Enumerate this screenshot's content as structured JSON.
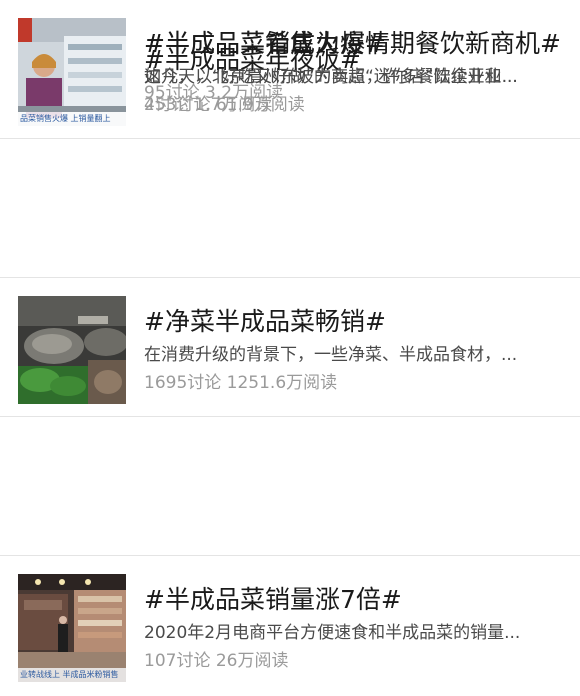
{
  "topics": [
    {
      "title": "#半成品菜肴成为疫情期餐饮新商机#",
      "summary": "这几天，北京眉州东坡的商超“迷你店”陆续开业...",
      "discussions": "453讨论",
      "reads": "61.9万阅读",
      "thumbnail_icon": "staff-masks-store-photo"
    },
    {
      "title": "#净菜半成品菜畅销#",
      "summary": "在消费升级的背景下，一些净菜、半成品食材，...",
      "discussions": "1695讨论",
      "reads": "1251.6万阅读",
      "thumbnail_icon": "packaged-vegetables-photo"
    },
    {
      "title": "#半成品菜销量涨7倍#",
      "summary": "2020年2月电商平台方便速食和半成品菜的销量...",
      "discussions": "107讨论",
      "reads": "26万阅读",
      "thumbnail_icon": "supermarket-aisle-photo",
      "thumbnail_caption": "业转战线上 半成品米粉销售"
    },
    {
      "title": "#半成品菜年夜饭#",
      "discussions": "95讨论",
      "reads": "3.2万阅读",
      "thumbnail_icon": "boxed-meals-photo"
    },
    {
      "title": "#半成品菜销售火爆#",
      "summary": "如今，以“好吃又好做”为卖点，许多餐饮企业和...",
      "discussions": "2讨论",
      "reads": "1.7万阅读",
      "thumbnail_icon": "shopper-fridge-photo",
      "thumbnail_caption": "品菜销售火爆 上销量翻上"
    }
  ]
}
